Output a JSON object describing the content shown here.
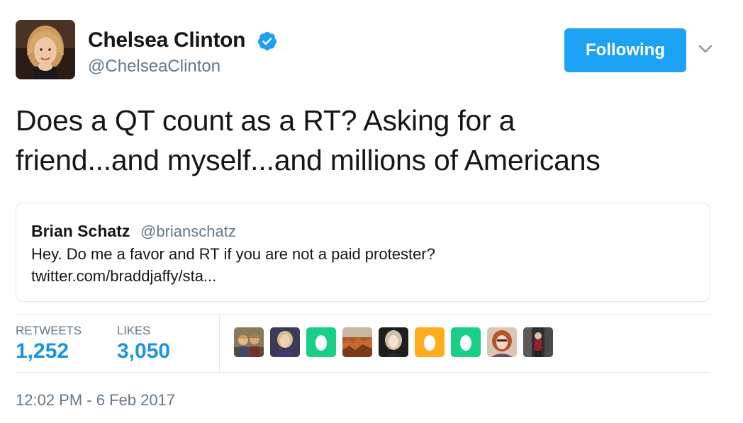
{
  "author": {
    "name": "Chelsea Clinton",
    "handle": "@ChelseaClinton",
    "verified": true,
    "avatar_icon": "profile-photo"
  },
  "follow_button": {
    "label": "Following",
    "color": "#1da1f2"
  },
  "menu_icon": "chevron-down-icon",
  "tweet": {
    "line1": "Does a QT count as a RT? Asking for a",
    "line2": "friend...and myself...and millions of Americans"
  },
  "quoted_tweet": {
    "name": "Brian Schatz",
    "handle": "@brianschatz",
    "line1": "Hey. Do me a favor and RT if you are not a paid protester?",
    "line2": "twitter.com/braddjaffy/sta..."
  },
  "stats": {
    "retweets_label": "RETWEETS",
    "retweets_value": "1,252",
    "likes_label": "LIKES",
    "likes_value": "3,050"
  },
  "likers": [
    {
      "kind": "photo-group",
      "icon": "user-avatar"
    },
    {
      "kind": "photo-woman",
      "icon": "user-avatar"
    },
    {
      "kind": "egg-green",
      "icon": "egg-avatar"
    },
    {
      "kind": "photo-canyon",
      "icon": "user-avatar"
    },
    {
      "kind": "photo-dark",
      "icon": "user-avatar"
    },
    {
      "kind": "egg-orange",
      "icon": "egg-avatar"
    },
    {
      "kind": "egg-green",
      "icon": "egg-avatar"
    },
    {
      "kind": "photo-redhead",
      "icon": "user-avatar"
    },
    {
      "kind": "photo-street",
      "icon": "user-avatar"
    }
  ],
  "timestamp": "12:02 PM - 6 Feb 2017",
  "colors": {
    "accent": "#1da1f2",
    "stat_value": "#1b95e0",
    "muted": "#657786",
    "border": "#e1e8ed",
    "egg_green": "#19cf86",
    "egg_orange": "#ffad1f"
  }
}
